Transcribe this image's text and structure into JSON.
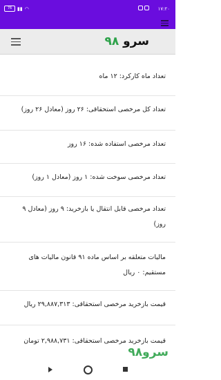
{
  "status": {
    "time": "۱۷:۲۰",
    "battery": "76"
  },
  "header": {
    "logo_text": "سرو",
    "logo_number": "۹۸"
  },
  "rows": [
    "تعداد ماه کارکرد: ۱۲ ماه",
    "تعداد کل مرخصی استحقاقی: ۲۶ روز (معادل ۲۶ روز)",
    "تعداد مرخصی استفاده شده: ۱۶ روز",
    "تعداد مرخصی سوخت شده: ۱ روز (معادل ۱ روز)",
    "تعداد مرخصی قابل انتقال یا بازخرید: ۹ روز (معادل ۹ روز)",
    "مالیات متعلقه بر اساس ماده ۹۱ قانون مالیات های مستقیم: ۰ ریال",
    "قیمت بازخرید مرخصی استحقاقی: ۲۹,۸۸۷,۳۱۳ ریال",
    "قیمت بازخرید مرخصی استحقاقی: ۲,۹۸۸,۷۳۱ تومان"
  ],
  "watermark": "سرو۹۸"
}
